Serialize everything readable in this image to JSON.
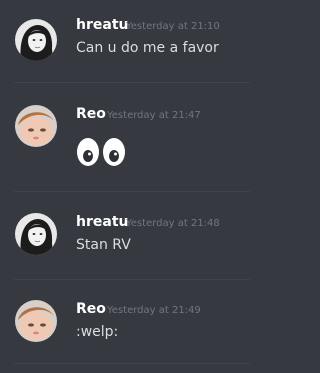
{
  "messages": [
    {
      "author": "hreatu",
      "timestamp": "Yesterday at 21:10",
      "content": "Can u do me a favor",
      "avatar_icon": "user-avatar-dark-hair"
    },
    {
      "author": "Reo",
      "timestamp": "Yesterday at 21:47",
      "content": "",
      "emoji": "eyes-emoji",
      "avatar_icon": "user-avatar-light-face"
    },
    {
      "author": "hreatu",
      "timestamp": "Yesterday at 21:48",
      "content": "Stan RV",
      "avatar_icon": "user-avatar-dark-hair"
    },
    {
      "author": "Reo",
      "timestamp": "Yesterday at 21:49",
      "content": ":welp:",
      "avatar_icon": "user-avatar-light-face"
    }
  ],
  "colors": {
    "background": "#36393f",
    "author": "#ffffff",
    "timestamp": "#72767d",
    "content": "#dcddde",
    "divider": "#40434a"
  }
}
